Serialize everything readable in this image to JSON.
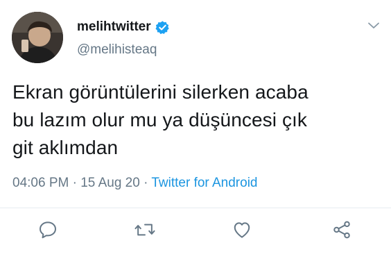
{
  "tweet": {
    "display_name": "melihtwitter",
    "handle": "@melihisteaq",
    "verified": true,
    "text_lines": [
      "Ekran görüntülerini silerken acaba",
      "bu lazım olur mu ya düşüncesi çık",
      "git aklımdan"
    ],
    "time": "04:06 PM",
    "separator": " · ",
    "date": "15 Aug 20",
    "source": "Twitter for Android"
  },
  "actions": [
    {
      "icon": "reply-icon"
    },
    {
      "icon": "retweet-icon"
    },
    {
      "icon": "like-icon"
    },
    {
      "icon": "share-icon"
    }
  ],
  "colors": {
    "text": "#14171a",
    "secondary": "#657786",
    "accent": "#1b95e0",
    "verified": "#1da1f2"
  }
}
